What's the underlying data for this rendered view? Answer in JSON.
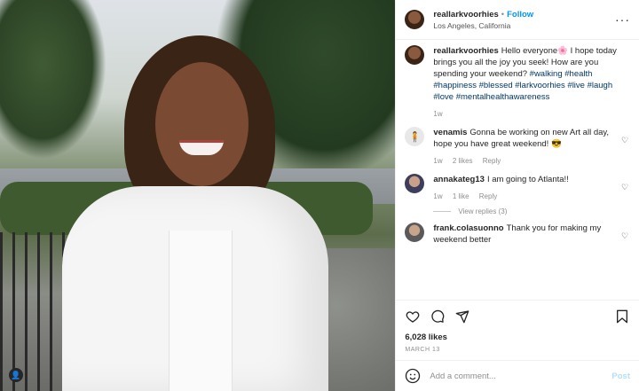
{
  "post": {
    "username": "reallarkvoorhies",
    "separator": "•",
    "follow_label": "Follow",
    "location": "Los Angeles, California",
    "more_glyph": "···",
    "caption": {
      "text_start": "Hello everyone",
      "emoji": "🌸",
      "text_mid": " I hope today brings you all the joy you seek! How are you spending your weekend? ",
      "hashtags": "#walking #health #happiness #blessed #larkvoorhies #live #laugh #love #mentalhealthawareness",
      "time": "1w"
    },
    "comments": [
      {
        "user": "venamis",
        "text": "Gonna be working on new Art all day, hope you have great weekend! 😎",
        "time": "1w",
        "likes": "2 likes",
        "reply": "Reply"
      },
      {
        "user": "annakateg13",
        "text": "I am going to Atlanta!!",
        "time": "1w",
        "likes": "1 like",
        "reply": "Reply",
        "view_replies": "View replies (3)"
      },
      {
        "user": "frank.colasuonno",
        "text": "Thank you for making my weekend better"
      }
    ],
    "likes": "6,028 likes",
    "date": "MARCH 13",
    "add_comment_placeholder": "Add a comment...",
    "post_label": "Post",
    "colors": {
      "accent": "#0095f6",
      "post_disabled": "#b2dffc",
      "text": "#262626",
      "muted": "#8e8e8e"
    }
  }
}
